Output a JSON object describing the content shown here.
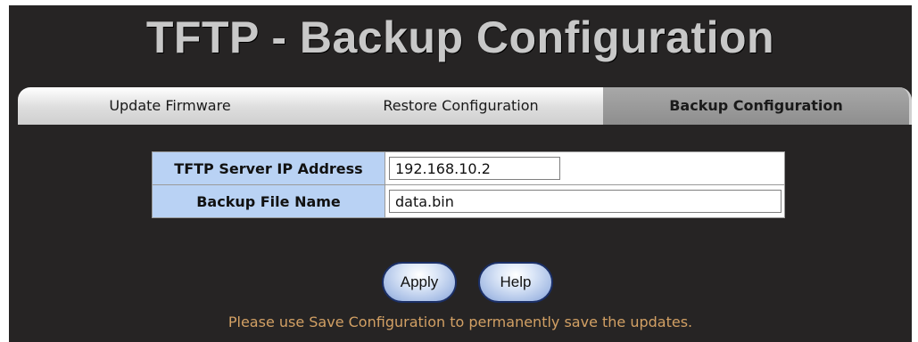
{
  "page": {
    "title": "TFTP - Backup Configuration"
  },
  "tabs": [
    {
      "label": "Update Firmware",
      "active": false
    },
    {
      "label": "Restore Configuration",
      "active": false
    },
    {
      "label": "Backup Configuration",
      "active": true
    }
  ],
  "form": {
    "server_ip": {
      "label": "TFTP Server IP Address",
      "value": "192.168.10.2"
    },
    "file_name": {
      "label": "Backup File Name",
      "value": "data.bin"
    }
  },
  "buttons": {
    "apply_label": "Apply",
    "help_label": "Help"
  },
  "notice": "Please use Save Configuration to permanently save the updates.",
  "colors": {
    "background": "#262424",
    "title": "#c8c8c8",
    "label_cell": "#b9d2f4",
    "notice_text": "#d2a064",
    "active_tab": "#999999"
  }
}
